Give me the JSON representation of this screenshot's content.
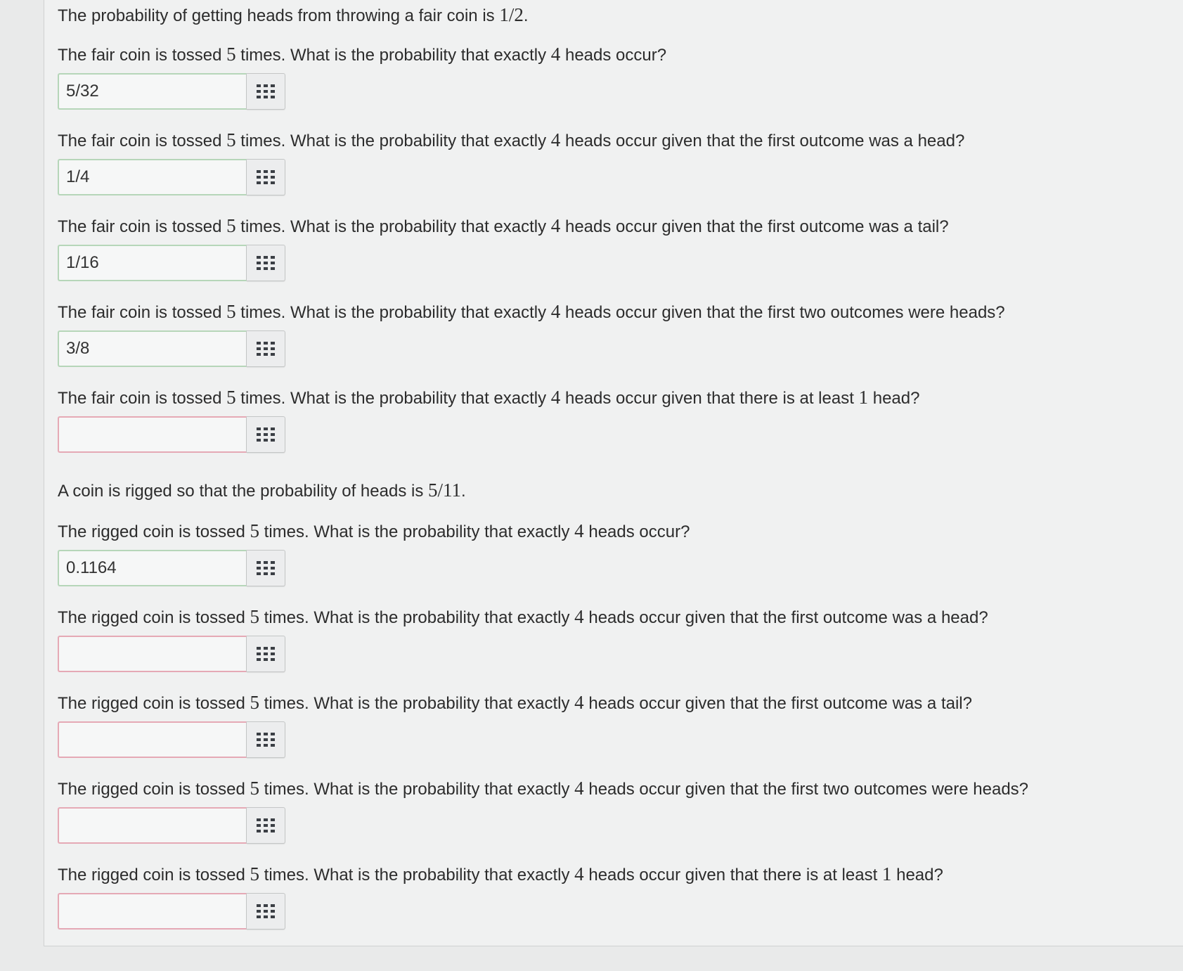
{
  "fair_intro": {
    "text": "The probability of getting heads from throwing a fair coin is ",
    "value": "1/2",
    "end": "."
  },
  "rigged_intro": {
    "text": "A coin is rigged so that the probability of heads is ",
    "value": "5/11",
    "end": "."
  },
  "icons": {
    "answer_button": "keypad-grid-icon"
  },
  "questions": [
    {
      "pre": "The fair coin is tossed ",
      "n": "5",
      "mid": " times. What is the probability that exactly ",
      "k": "4",
      "post": " heads occur?",
      "answer": "5/32"
    },
    {
      "pre": "The fair coin is tossed ",
      "n": "5",
      "mid": " times. What is the probability that exactly ",
      "k": "4",
      "post": " heads occur given that the first outcome was a head?",
      "answer": "1/4"
    },
    {
      "pre": "The fair coin is tossed ",
      "n": "5",
      "mid": " times. What is the probability that exactly ",
      "k": "4",
      "post": " heads occur given that the first outcome was a tail?",
      "answer": "1/16"
    },
    {
      "pre": "The fair coin is tossed ",
      "n": "5",
      "mid": " times. What is the probability that exactly ",
      "k": "4",
      "post": " heads occur given that the first two outcomes were heads?",
      "answer": "3/8"
    },
    {
      "pre": "The fair coin is tossed ",
      "n": "5",
      "mid": " times. What is the probability that exactly ",
      "k": "4",
      "post": " heads occur given that there is at least ",
      "extra": "1",
      "post2": " head?",
      "answer": ""
    },
    {
      "pre": "The rigged coin is tossed ",
      "n": "5",
      "mid": " times. What is the probability that exactly ",
      "k": "4",
      "post": " heads occur?",
      "answer": "0.1164"
    },
    {
      "pre": "The rigged coin is tossed ",
      "n": "5",
      "mid": " times. What is the probability that exactly ",
      "k": "4",
      "post": " heads occur given that the first outcome was a head?",
      "answer": ""
    },
    {
      "pre": "The rigged coin is tossed ",
      "n": "5",
      "mid": " times. What is the probability that exactly ",
      "k": "4",
      "post": " heads occur given that the first outcome was a tail?",
      "answer": ""
    },
    {
      "pre": "The rigged coin is tossed ",
      "n": "5",
      "mid": " times. What is the probability that exactly ",
      "k": "4",
      "post": " heads occur given that the first two outcomes were heads?",
      "answer": ""
    },
    {
      "pre": "The rigged coin is tossed ",
      "n": "5",
      "mid": " times. What is the probability that exactly ",
      "k": "4",
      "post": " heads occur given that there is at least ",
      "extra": "1",
      "post2": " head?",
      "answer": ""
    }
  ]
}
